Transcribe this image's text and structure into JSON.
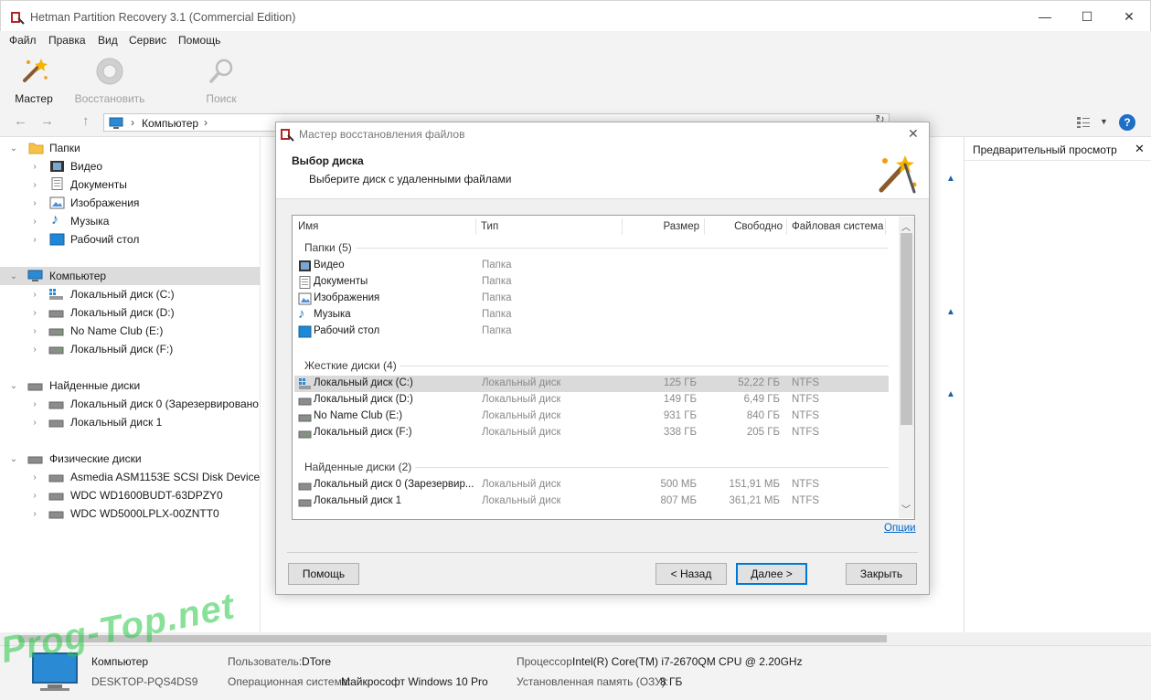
{
  "app": {
    "title": "Hetman Partition Recovery 3.1 (Commercial Edition)",
    "window_buttons": {
      "minimize": "—",
      "maximize": "☐",
      "close": "✕"
    }
  },
  "menu": [
    "Файл",
    "Правка",
    "Вид",
    "Сервис",
    "Помощь"
  ],
  "toolbar": {
    "wizard": "Мастер",
    "restore": "Восстановить",
    "search": "Поиск"
  },
  "nav": {
    "back": "←",
    "forward": "→",
    "up": "↑",
    "breadcrumb": "Компьютер",
    "sep": "›",
    "refresh": "↻",
    "help": "?"
  },
  "tree": {
    "folders": {
      "label": "Папки",
      "items": [
        "Видео",
        "Документы",
        "Изображения",
        "Музыка",
        "Рабочий стол"
      ]
    },
    "computer": {
      "label": "Компьютер",
      "items": [
        "Локальный диск (C:)",
        "Локальный диск (D:)",
        "No Name Club (E:)",
        "Локальный диск (F:)"
      ]
    },
    "found": {
      "label": "Найденные диски",
      "items": [
        "Локальный диск 0 (Зарезервировано",
        "Локальный диск 1"
      ]
    },
    "physical": {
      "label": "Физические диски",
      "items": [
        "Asmedia ASM1153E SCSI Disk Device",
        "WDC WD1600BUDT-63DPZY0",
        "WDC WD5000LPLX-00ZNTT0"
      ]
    }
  },
  "preview": {
    "title": "Предварительный просмотр"
  },
  "dialog": {
    "title": "Мастер восстановления файлов",
    "heading": "Выбор диска",
    "subheading": "Выберите диск с удаленными файлами",
    "columns": {
      "name": "Имя",
      "type": "Тип",
      "size": "Размер",
      "free": "Свободно",
      "fs": "Файловая система"
    },
    "groups": {
      "folders": {
        "label": "Папки (5)",
        "rows": [
          {
            "name": "Видео",
            "type": "Папка"
          },
          {
            "name": "Документы",
            "type": "Папка"
          },
          {
            "name": "Изображения",
            "type": "Папка"
          },
          {
            "name": "Музыка",
            "type": "Папка"
          },
          {
            "name": "Рабочий стол",
            "type": "Папка"
          }
        ]
      },
      "hard": {
        "label": "Жесткие диски (4)",
        "rows": [
          {
            "name": "Локальный диск (C:)",
            "type": "Локальный диск",
            "size": "125 ГБ",
            "free": "52,22 ГБ",
            "fs": "NTFS"
          },
          {
            "name": "Локальный диск (D:)",
            "type": "Локальный диск",
            "size": "149 ГБ",
            "free": "6,49 ГБ",
            "fs": "NTFS"
          },
          {
            "name": "No Name Club (E:)",
            "type": "Локальный диск",
            "size": "931 ГБ",
            "free": "840 ГБ",
            "fs": "NTFS"
          },
          {
            "name": "Локальный диск (F:)",
            "type": "Локальный диск",
            "size": "338 ГБ",
            "free": "205 ГБ",
            "fs": "NTFS"
          }
        ]
      },
      "found": {
        "label": "Найденные диски (2)",
        "rows": [
          {
            "name": "Локальный диск 0 (Зарезервир...",
            "type": "Локальный диск",
            "size": "500 МБ",
            "free": "151,91 МБ",
            "fs": "NTFS"
          },
          {
            "name": "Локальный диск 1",
            "type": "Локальный диск",
            "size": "807 МБ",
            "free": "361,21 МБ",
            "fs": "NTFS"
          }
        ]
      }
    },
    "options_link": "Опции",
    "buttons": {
      "help": "Помощь",
      "back": "< Назад",
      "next": "Далее >",
      "close": "Закрыть"
    }
  },
  "status": {
    "computer_label": "Компьютер",
    "computer_name": "DESKTOP-PQS4DS9",
    "user_label": "Пользователь:",
    "user": "DTore",
    "os_label": "Операционная система:",
    "os": "Майкрософт Windows 10 Pro",
    "cpu_label": "Процессор:",
    "cpu": "Intel(R) Core(TM) i7-2670QM CPU @ 2.20GHz",
    "ram_label": "Установленная память (ОЗУ):",
    "ram": "8 ГБ"
  },
  "watermark": "Prog-Top.net",
  "colors": {
    "selection": "#dcdcdc",
    "link": "#0066cc",
    "folder": "#f6c24a",
    "accent": "#0078d7"
  }
}
